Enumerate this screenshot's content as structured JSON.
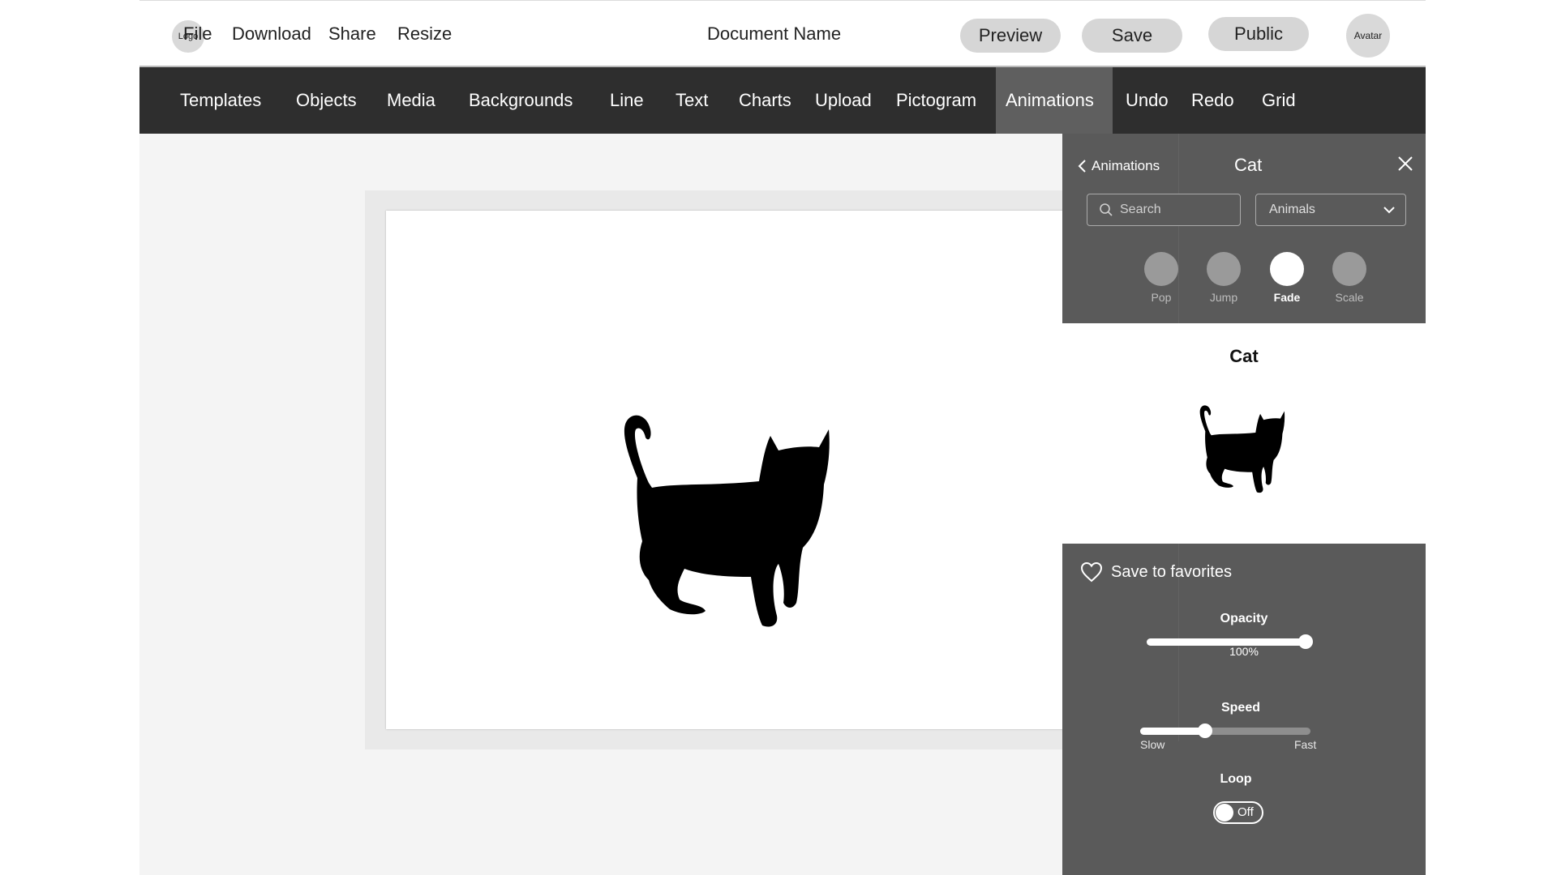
{
  "header": {
    "logo": "Logo",
    "menu": [
      "File",
      "Download",
      "Share",
      "Resize"
    ],
    "document_name": "Document Name",
    "buttons": {
      "preview": "Preview",
      "save": "Save",
      "public": "Public"
    },
    "avatar": "Avatar"
  },
  "toolbar": {
    "items": [
      "Templates",
      "Objects",
      "Media",
      "Backgrounds",
      "Line",
      "Text",
      "Charts",
      "Upload",
      "Pictogram",
      "Animations",
      "Undo",
      "Redo",
      "Grid"
    ],
    "active": "Animations"
  },
  "canvas": {
    "object": "cat-silhouette"
  },
  "panel": {
    "back_label": "Animations",
    "title": "Cat",
    "search_placeholder": "Search",
    "category": "Animals",
    "animations": [
      "Pop",
      "Jump",
      "Fade",
      "Scale"
    ],
    "selected_animation": "Fade",
    "preview_title": "Cat",
    "favorite_label": "Save to favorites",
    "opacity": {
      "label": "Opacity",
      "value_text": "100%",
      "value": 1.0
    },
    "speed": {
      "label": "Speed",
      "min_label": "Slow",
      "max_label": "Fast",
      "value": 0.38
    },
    "loop": {
      "label": "Loop",
      "state": "Off"
    }
  },
  "colors": {
    "toolbar_bg": "#2e2e2e",
    "toolbar_active": "#5f5f5f",
    "panel_bg": "#5a5a5a",
    "pill_bg": "#d6d6d6"
  }
}
